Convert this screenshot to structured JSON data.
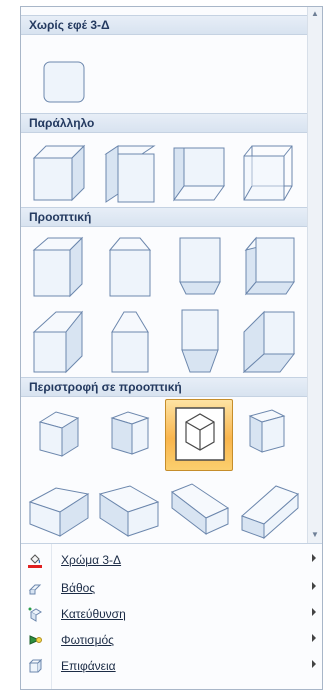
{
  "gallery": {
    "sections": [
      {
        "title": "Χωρίς εφέ 3-Δ"
      },
      {
        "title": "Παράλληλο"
      },
      {
        "title": "Προοπτική"
      },
      {
        "title": "Περιστροφή σε προοπτική"
      }
    ]
  },
  "menu": {
    "items": [
      {
        "label": "Χρώμα 3-Δ",
        "icon": "paint-bucket-icon"
      },
      {
        "label": "Βάθος",
        "icon": "depth-icon"
      },
      {
        "label": "Κατεύθυνση",
        "icon": "direction-icon"
      },
      {
        "label": "Φωτισμός",
        "icon": "lighting-icon"
      },
      {
        "label": "Επιφάνεια",
        "icon": "surface-icon"
      }
    ]
  },
  "colors": {
    "selected_tile": "#f9b54d",
    "header_bg": "#dce6f2",
    "header_text": "#243a60",
    "color_swatch": "#e02020"
  }
}
